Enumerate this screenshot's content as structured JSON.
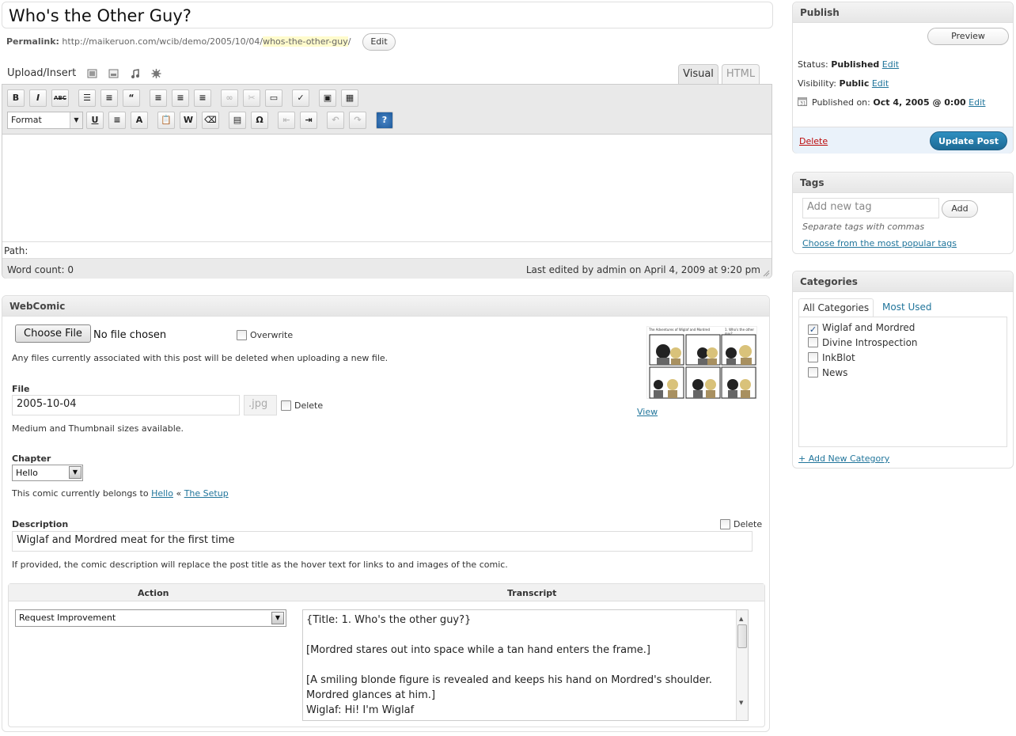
{
  "post": {
    "title": "Who's the Other Guy?",
    "permalink_label": "Permalink:",
    "permalink_base": "http://maikeruon.com/wcib/demo/2005/10/04/",
    "permalink_slug": "whos-the-other-guy",
    "permalink_end": "/",
    "edit_label": "Edit"
  },
  "editor": {
    "upload_label": "Upload/Insert",
    "tab_visual": "Visual",
    "tab_html": "HTML",
    "format_label": "Format",
    "path_label": "Path:",
    "word_count": "Word count: 0",
    "last_edited": "Last edited by admin on April 4, 2009 at 9:20 pm",
    "toolbar_row1": [
      {
        "name": "bold-button",
        "glyph": "B"
      },
      {
        "name": "italic-button",
        "glyph": "I"
      },
      {
        "name": "strikethrough-button",
        "glyph": "ABC"
      },
      {
        "name": "bullet-list-button",
        "glyph": "☰"
      },
      {
        "name": "numbered-list-button",
        "glyph": "≡"
      },
      {
        "name": "blockquote-button",
        "glyph": "“"
      },
      {
        "name": "align-left-button",
        "glyph": "≡"
      },
      {
        "name": "align-center-button",
        "glyph": "≡"
      },
      {
        "name": "align-right-button",
        "glyph": "≡"
      },
      {
        "name": "link-button",
        "glyph": "∞"
      },
      {
        "name": "unlink-button",
        "glyph": "✂"
      },
      {
        "name": "more-tag-button",
        "glyph": "▭"
      },
      {
        "name": "spellcheck-button",
        "glyph": "✓"
      },
      {
        "name": "fullscreen-button",
        "glyph": "▣"
      },
      {
        "name": "kitchen-sink-button",
        "glyph": "▦"
      }
    ],
    "toolbar_row2": [
      {
        "name": "underline-button",
        "glyph": "U"
      },
      {
        "name": "justify-button",
        "glyph": "≡"
      },
      {
        "name": "text-color-button",
        "glyph": "A"
      },
      {
        "name": "paste-text-button",
        "glyph": "📋"
      },
      {
        "name": "paste-word-button",
        "glyph": "W"
      },
      {
        "name": "remove-format-button",
        "glyph": "⌫"
      },
      {
        "name": "insert-media-button",
        "glyph": "▤"
      },
      {
        "name": "special-char-button",
        "glyph": "Ω"
      },
      {
        "name": "outdent-button",
        "glyph": "⇤"
      },
      {
        "name": "indent-button",
        "glyph": "⇥"
      },
      {
        "name": "undo-button",
        "glyph": "↶"
      },
      {
        "name": "redo-button",
        "glyph": "↷"
      },
      {
        "name": "help-button",
        "glyph": "?"
      }
    ]
  },
  "webcomic": {
    "heading": "WebComic",
    "choose_file": "Choose File",
    "no_file": "No file chosen",
    "overwrite": "Overwrite",
    "upload_note": "Any files currently associated with this post will be deleted when uploading a new file.",
    "view_link": "View",
    "file_label": "File",
    "file_value": "2005-10-04",
    "file_ext": ".jpg",
    "delete_label": "Delete",
    "sizes_note": "Medium and Thumbnail sizes available.",
    "chapter_label": "Chapter",
    "chapter_value": "Hello",
    "belongs_prefix": "This comic currently belongs to",
    "belongs_link1": "Hello",
    "belongs_sep": "«",
    "belongs_link2": "The Setup",
    "description_label": "Description",
    "description_value": "Wiglaf and Mordred meat for the first time",
    "description_note": "If provided, the comic description will replace the post title as the hover text for links to and images of the comic.",
    "action_header": "Action",
    "transcript_header": "Transcript",
    "action_value": "Request Improvement",
    "transcript_lines": [
      "{Title: 1. Who's the other guy?}",
      "",
      "[Mordred stares out into space while a tan hand enters the frame.]",
      "",
      "[A smiling blonde figure is revealed and keeps his hand on Mordred's shoulder.",
      "Mordred glances at him.]",
      "Wiglaf: Hi! I'm Wiglaf"
    ],
    "thumb_title": "The Adventures of Wiglaf and Mordred",
    "thumb_subtitle": "1. Who's the other guy?"
  },
  "publish": {
    "heading": "Publish",
    "preview": "Preview",
    "status_label": "Status:",
    "status_value": "Published",
    "visibility_label": "Visibility:",
    "visibility_value": "Public",
    "published_label": "Published on:",
    "published_value": "Oct 4, 2005 @ 0:00",
    "edit": "Edit",
    "delete": "Delete",
    "update": "Update Post"
  },
  "tags": {
    "heading": "Tags",
    "placeholder": "Add new tag",
    "add": "Add",
    "hint": "Separate tags with commas",
    "popular": "Choose from the most popular tags"
  },
  "categories": {
    "heading": "Categories",
    "tab_all": "All Categories",
    "tab_used": "Most Used",
    "items": [
      {
        "label": "Wiglaf and Mordred",
        "checked": true
      },
      {
        "label": "Divine Introspection",
        "checked": false
      },
      {
        "label": "InkBlot",
        "checked": false
      },
      {
        "label": "News",
        "checked": false
      }
    ],
    "add_new": "+ Add New Category"
  },
  "colors": {
    "link": "#21759b",
    "accent": "#2e8fc0",
    "delete": "#bc0b0b"
  }
}
